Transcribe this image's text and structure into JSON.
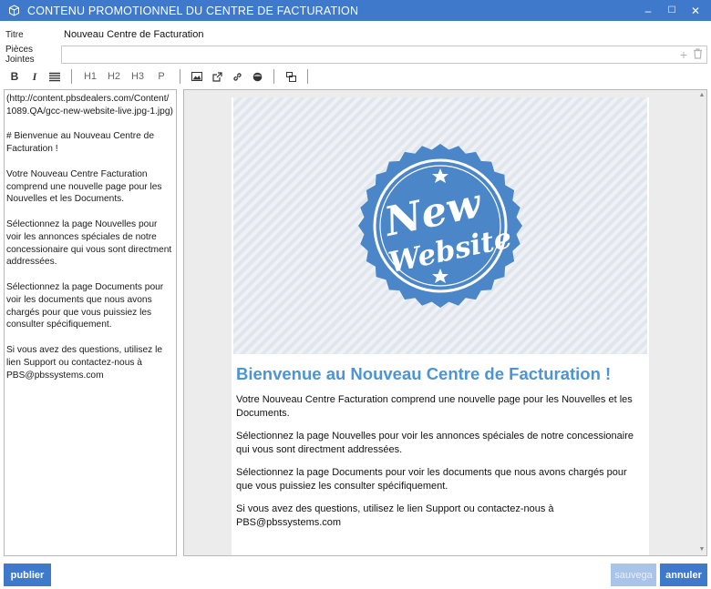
{
  "window": {
    "title": "CONTENU PROMOTIONNEL DU CENTRE DE FACTURATION",
    "app_icon": "cube-icon",
    "minimize_glyph": "–",
    "maximize_glyph": "☐",
    "close_glyph": "✕"
  },
  "fields": {
    "title_label": "Titre",
    "title_value": "Nouveau Centre de Facturation",
    "attachments_label": "Pièces Jointes",
    "attachments_value": "",
    "add_glyph": "+",
    "delete_glyph": "🗑"
  },
  "toolbar": {
    "bold": "B",
    "italic": "I",
    "list_icon": "list-icon",
    "h1": "H1",
    "h2": "H2",
    "h3": "H3",
    "p": "P",
    "image_icon": "image-icon",
    "external_link_icon": "external-link-icon",
    "link_icon": "link-icon",
    "circle_icon": "circle-icon",
    "layout_icon": "layout-icon"
  },
  "editor": {
    "lines": [
      "(http://content.pbsdealers.com/Content/1089.QA/gcc-new-website-live.jpg-1.jpg)",
      "# Bienvenue au Nouveau Centre de Facturation !",
      "Votre Nouveau Centre Facturation comprend une nouvelle page pour les Nouvelles et les Documents.",
      "Sélectionnez la page Nouvelles pour voir les annonces spéciales de notre concessionaire qui vous sont directment addressées.",
      "Sélectionnez la page Documents pour voir les documents que nous avons chargés pour que vous puissiez les consulter spécifiquement.",
      "Si vous avez des questions, utilisez le lien Support ou contactez-nous à PBS@pbssystems.com"
    ]
  },
  "preview": {
    "hero_line1": "New",
    "hero_line2": "Website",
    "heading": "Bienvenue au Nouveau Centre de Facturation !",
    "paragraphs": [
      "Votre Nouveau Centre Facturation comprend une nouvelle page pour les Nouvelles et les Documents.",
      "Sélectionnez la page Nouvelles pour voir les annonces spéciales de notre concessionaire qui vous sont directment addressées.",
      "Sélectionnez la page Documents pour voir les documents que nous avons chargés pour que vous puissiez les consulter spécifiquement.",
      "Si vous avez des questions, utilisez le lien Support ou contactez-nous à PBS@pbssystems.com"
    ]
  },
  "buttons": {
    "publish": "publier",
    "save": "sauvega",
    "cancel": "annuler"
  },
  "colors": {
    "accent": "#3f79cc",
    "heading": "#4d94d6",
    "seal": "#4a86c8",
    "save_disabled": "#a8c4ea"
  }
}
